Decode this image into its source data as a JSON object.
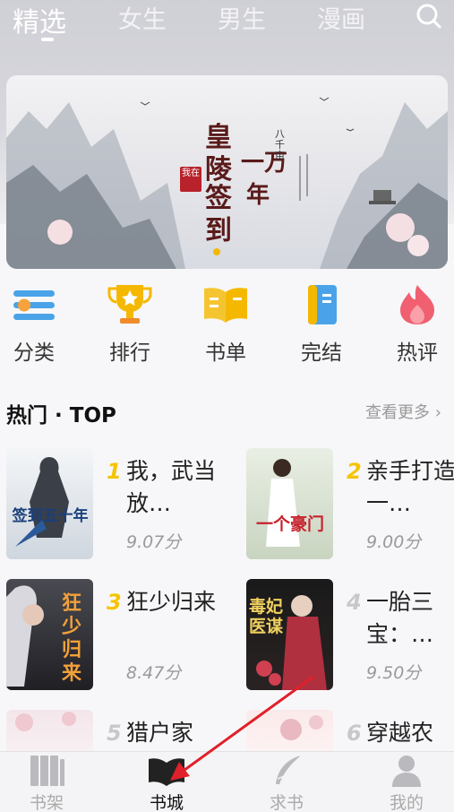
{
  "top_tabs": [
    "精选",
    "女生",
    "男生",
    "漫画"
  ],
  "banner": {
    "title_line1": "皇陵",
    "title_line2": "签到",
    "title_right1": "一万",
    "title_right2": "年",
    "seal_text": "我在",
    "side_small": "八千亩"
  },
  "categories": [
    {
      "label": "分类",
      "icon": "category-list-icon"
    },
    {
      "label": "排行",
      "icon": "trophy-icon"
    },
    {
      "label": "书单",
      "icon": "open-book-icon"
    },
    {
      "label": "完结",
      "icon": "finished-book-icon"
    },
    {
      "label": "热评",
      "icon": "flame-icon"
    }
  ],
  "section": {
    "title": "热门 · TOP",
    "more": "查看更多 ›"
  },
  "books": [
    {
      "rank": "1",
      "title": "我，武当放…",
      "score": "9.07分",
      "cover_text": "签到五十年",
      "rank_color": "#f5c400"
    },
    {
      "rank": "2",
      "title": "亲手打造一…",
      "score": "9.00分",
      "cover_text": "一个豪门",
      "rank_color": "#f5c400"
    },
    {
      "rank": "3",
      "title": "狂少归来",
      "score": "8.47分",
      "cover_text": "狂少归来",
      "rank_color": "#f5c400"
    },
    {
      "rank": "4",
      "title": "一胎三宝：…",
      "score": "9.50分",
      "cover_text": "毒妃医谋",
      "rank_color": "#c8c8c8"
    },
    {
      "rank": "5",
      "title": "猎户家",
      "score": "",
      "cover_text": "",
      "rank_color": "#c8c8c8"
    },
    {
      "rank": "6",
      "title": "穿越农",
      "score": "",
      "cover_text": "",
      "rank_color": "#c8c8c8"
    }
  ],
  "bottom_nav": [
    {
      "label": "书架",
      "icon": "bookshelf-icon"
    },
    {
      "label": "书城",
      "icon": "bookstore-icon"
    },
    {
      "label": "求书",
      "icon": "feather-icon"
    },
    {
      "label": "我的",
      "icon": "user-icon"
    }
  ],
  "colors": {
    "accent": "#f5b800",
    "annotation_arrow": "#e0202a"
  }
}
